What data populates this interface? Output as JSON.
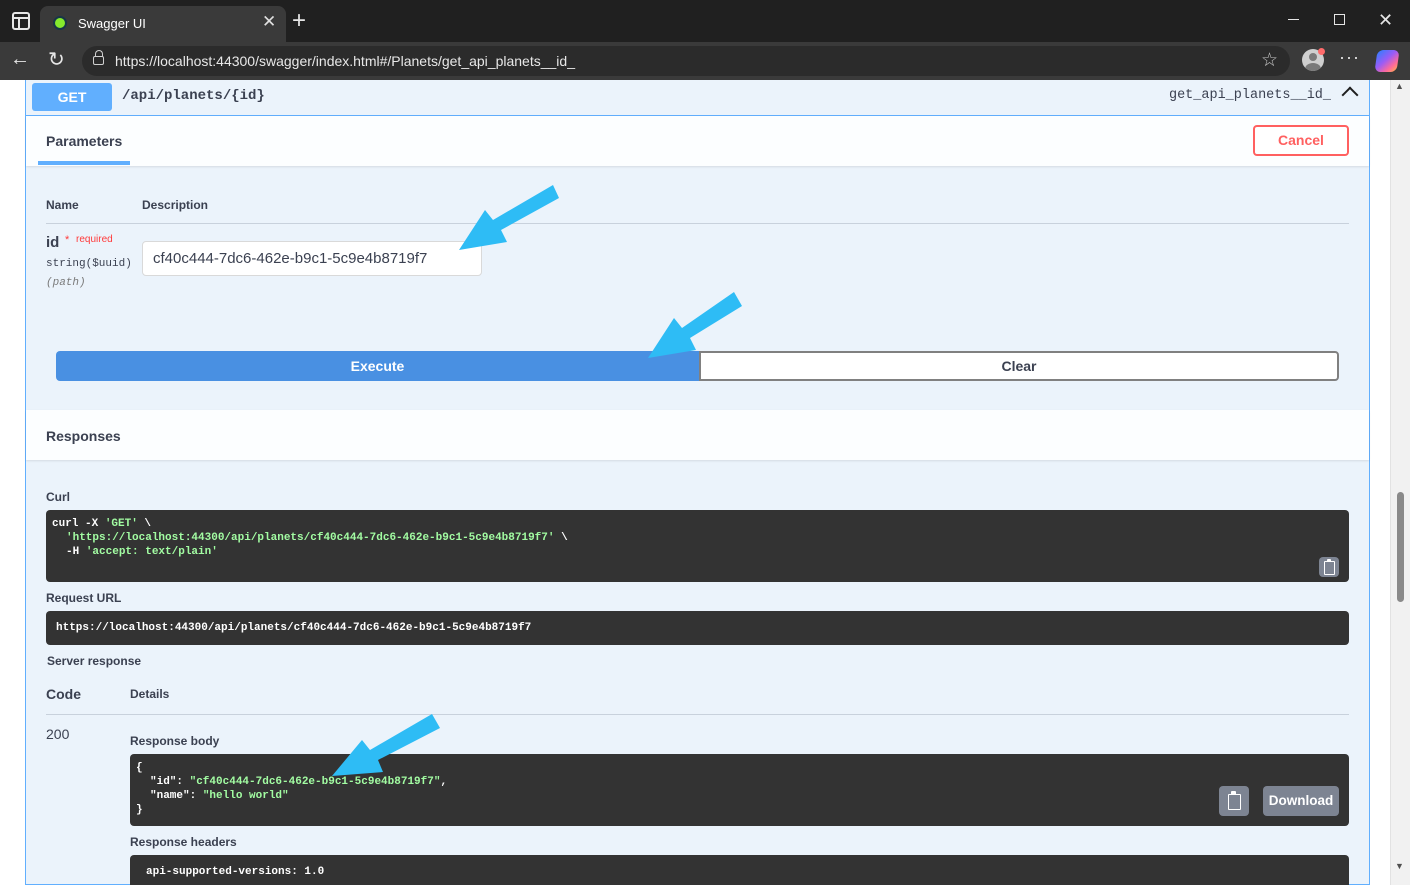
{
  "browser": {
    "tab_title": "Swagger UI",
    "tab_close": "✕",
    "new_tab": "+",
    "url": "https://localhost:44300/swagger/index.html#/Planets/get_api_planets__id_",
    "window_close": "✕"
  },
  "operation": {
    "method": "GET",
    "path": "/api/planets/{id}",
    "operation_id": "get_api_planets__id_"
  },
  "parameters": {
    "title": "Parameters",
    "cancel_label": "Cancel",
    "col_name": "Name",
    "col_description": "Description",
    "items": [
      {
        "name": "id",
        "required_star": "*",
        "required_label": "required",
        "type": "string($uuid)",
        "in": "(path)",
        "value": "cf40c444-7dc6-462e-b9c1-5c9e4b8719f7"
      }
    ]
  },
  "actions": {
    "execute_label": "Execute",
    "clear_label": "Clear"
  },
  "responses": {
    "title": "Responses",
    "curl_label": "Curl",
    "curl_line1_cmd": "curl -X ",
    "curl_line1_method": "'GET'",
    "curl_line1_tail": " \\",
    "curl_line2_url": "'https://localhost:44300/api/planets/cf40c444-7dc6-462e-b9c1-5c9e4b8719f7'",
    "curl_line2_tail": " \\",
    "curl_line3_flag": "-H ",
    "curl_line3_header": "'accept: text/plain'",
    "request_url_label": "Request URL",
    "request_url": "https://localhost:44300/api/planets/cf40c444-7dc6-462e-b9c1-5c9e4b8719f7",
    "server_response_label": "Server response",
    "code_header": "Code",
    "details_header": "Details",
    "status_code": "200",
    "response_body_label": "Response body",
    "body_open": "{",
    "body_id_key": "\"id\": ",
    "body_id_value": "\"cf40c444-7dc6-462e-b9c1-5c9e4b8719f7\"",
    "body_id_comma": ",",
    "body_name_key": "\"name\": ",
    "body_name_value": "\"hello world\"",
    "body_close": "}",
    "download_label": "Download",
    "response_headers_label": "Response headers",
    "response_header_line": "api-supported-versions: 1.0"
  },
  "colors": {
    "get_accent": "#61affe",
    "execute_bg": "#4990e2",
    "cancel": "#ff6060",
    "code_bg": "#333333",
    "string_green": "#a2fca2",
    "annotation_arrow": "#2ebcf5"
  }
}
